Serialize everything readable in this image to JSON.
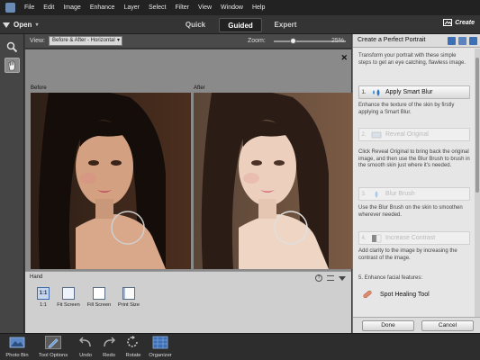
{
  "menubar": {
    "items": [
      "File",
      "Edit",
      "Image",
      "Enhance",
      "Layer",
      "Select",
      "Filter",
      "View",
      "Window",
      "Help"
    ]
  },
  "modebar": {
    "open_label": "Open",
    "tabs": [
      {
        "label": "Quick",
        "active": false
      },
      {
        "label": "Guided",
        "active": true
      },
      {
        "label": "Expert",
        "active": false
      }
    ],
    "create_label": "Create"
  },
  "options": {
    "view_label": "View:",
    "view_value": "Before & After - Horizontal",
    "zoom_label": "Zoom:",
    "zoom_value": "25%",
    "zoom_fraction": 0.25
  },
  "canvas": {
    "before_label": "Before",
    "after_label": "After"
  },
  "hand_panel": {
    "title": "Hand",
    "options": [
      {
        "label": "1:1",
        "icon": "1:1"
      },
      {
        "label": "Fit Screen"
      },
      {
        "label": "Fill Screen"
      },
      {
        "label": "Print Size"
      }
    ]
  },
  "right_panel": {
    "title": "Create a Perfect Portrait",
    "intro": "Transform your portrait with these simple steps to get an eye catching, flawless image.",
    "steps": [
      {
        "num": "1.",
        "label": "Apply Smart Blur",
        "enabled": true,
        "desc": "Enhance the texture of the skin by firstly applying a Smart Blur."
      },
      {
        "num": "2.",
        "label": "Reveal Original",
        "enabled": false,
        "desc": "Click Reveal Original to bring back the original image, and then use the Blur Brush to brush in the smooth skin just where it's needed."
      },
      {
        "num": "3.",
        "label": "Blur Brush",
        "enabled": false,
        "desc": "Use the Blur Brush on the skin to smoothen wherever needed."
      },
      {
        "num": "4.",
        "label": "Increase Contrast",
        "enabled": false,
        "desc": "Add clarity to the image by increasing the contrast of the image."
      }
    ],
    "section5": "5. Enhance facial features:",
    "spot_tool": "Spot Healing Tool",
    "done_label": "Done",
    "cancel_label": "Cancel"
  },
  "bottombar": {
    "items": [
      {
        "label": "Photo Bin",
        "active": false
      },
      {
        "label": "Tool Options",
        "active": true
      },
      {
        "label": "Undo",
        "active": false
      },
      {
        "label": "Redo",
        "active": false
      },
      {
        "label": "Rotate",
        "active": false
      },
      {
        "label": "Organizer",
        "active": false
      }
    ]
  },
  "colors": {
    "accent_blue": "#3b6fb6",
    "panel_bg": "#e6e6e6",
    "canvas_bg": "#8a8a8a"
  }
}
